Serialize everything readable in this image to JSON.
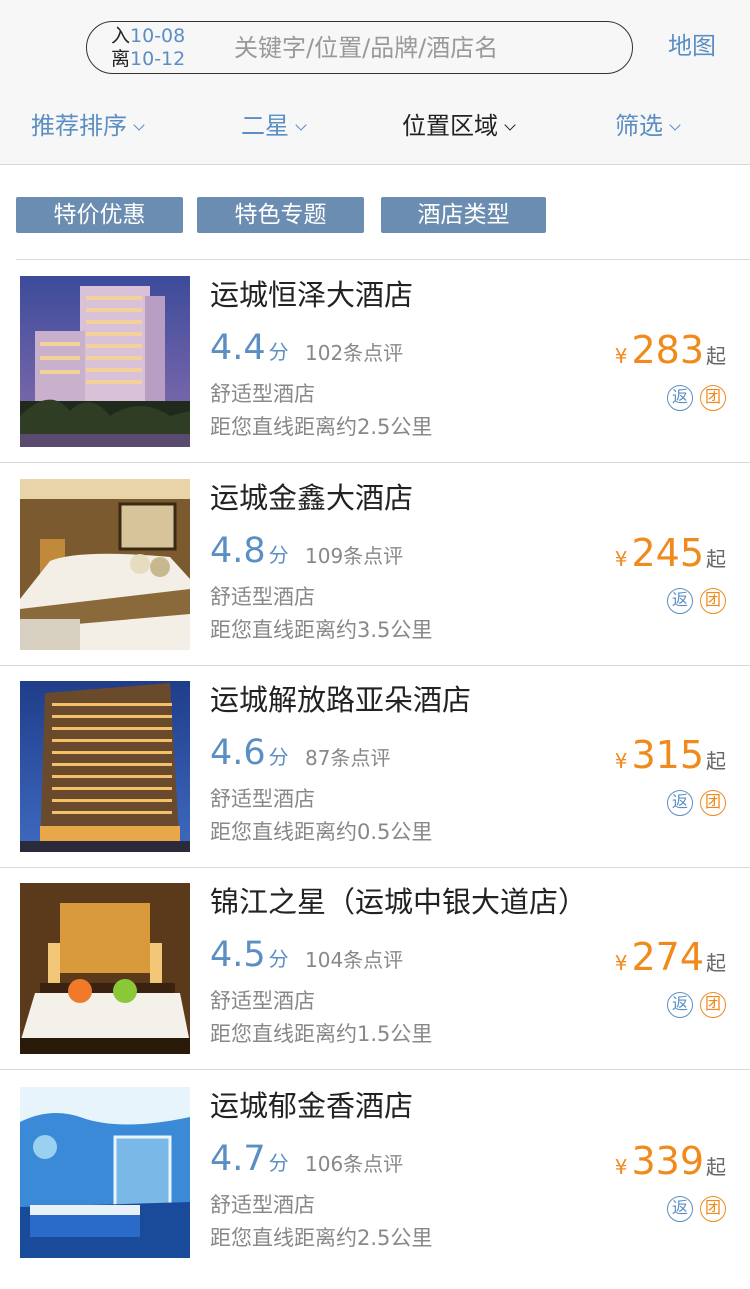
{
  "search": {
    "checkin_label": "入",
    "checkin_date": "10-08",
    "checkout_label": "离",
    "checkout_date": "10-12",
    "placeholder": "关键字/位置/品牌/酒店名",
    "map_label": "地图"
  },
  "sort_bar": [
    {
      "label": "推荐排序",
      "active": false
    },
    {
      "label": "二星",
      "active": false
    },
    {
      "label": "位置区域",
      "active": true
    },
    {
      "label": "筛选",
      "active": false
    }
  ],
  "chips": [
    "特价优惠",
    "特色专题",
    "酒店类型"
  ],
  "colors": {
    "accent": "#5b8fc4",
    "price": "#f08a1c",
    "chip_bg": "#6b8db1"
  },
  "hotels": [
    {
      "name": "运城恒泽大酒店",
      "score": "4.4",
      "score_unit": "分",
      "reviews": "102条点评",
      "type": "舒适型酒店",
      "distance": "距您直线距离约2.5公里",
      "currency": "¥",
      "price": "283",
      "price_suffix": "起",
      "badge_fan": "返",
      "badge_tuan": "团",
      "image": "hotel-tower-night"
    },
    {
      "name": "运城金鑫大酒店",
      "score": "4.8",
      "score_unit": "分",
      "reviews": "109条点评",
      "type": "舒适型酒店",
      "distance": "距您直线距离约3.5公里",
      "currency": "¥",
      "price": "245",
      "price_suffix": "起",
      "badge_fan": "返",
      "badge_tuan": "团",
      "image": "hotel-bedroom"
    },
    {
      "name": "运城解放路亚朵酒店",
      "score": "4.6",
      "score_unit": "分",
      "reviews": "87条点评",
      "type": "舒适型酒店",
      "distance": "距您直线距离约0.5公里",
      "currency": "¥",
      "price": "315",
      "price_suffix": "起",
      "badge_fan": "返",
      "badge_tuan": "团",
      "image": "hotel-building-dusk"
    },
    {
      "name": "锦江之星（运城中银大道店）",
      "score": "4.5",
      "score_unit": "分",
      "reviews": "104条点评",
      "type": "舒适型酒店",
      "distance": "距您直线距离约1.5公里",
      "currency": "¥",
      "price": "274",
      "price_suffix": "起",
      "badge_fan": "返",
      "badge_tuan": "团",
      "image": "hotel-bedroom-warm"
    },
    {
      "name": "运城郁金香酒店",
      "score": "4.7",
      "score_unit": "分",
      "reviews": "106条点评",
      "type": "舒适型酒店",
      "distance": "距您直线距离约2.5公里",
      "currency": "¥",
      "price": "339",
      "price_suffix": "起",
      "badge_fan": "返",
      "badge_tuan": "团",
      "image": "hotel-ocean-themed-room"
    }
  ]
}
